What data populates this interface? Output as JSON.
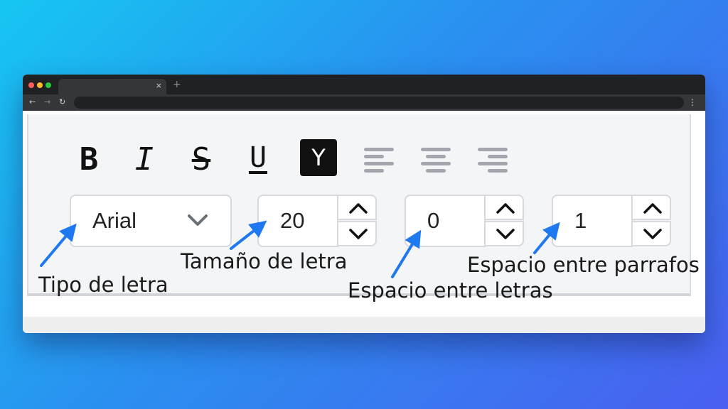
{
  "browser": {
    "tab_close": "×",
    "new_tab": "+",
    "back": "←",
    "forward": "→",
    "reload": "↻",
    "menu": "⋮"
  },
  "toolbar": {
    "bold": "B",
    "italic": "I",
    "strikethrough": "S",
    "underline": "U",
    "highlight": "Y",
    "align_icons": [
      "align-left-icon",
      "align-center-icon",
      "align-right-icon"
    ]
  },
  "controls": {
    "font_family": {
      "value": "Arial"
    },
    "font_size": {
      "value": "20"
    },
    "letter_spacing": {
      "value": "0"
    },
    "paragraph_spacing": {
      "value": "1"
    }
  },
  "annotations": {
    "font_family": "Tipo de letra",
    "font_size": "Tamaño de letra",
    "letter_spacing": "Espacio entre letras",
    "paragraph_spacing": "Espacio entre parrafos"
  },
  "colors": {
    "arrow": "#1e78f0",
    "icon": "#111111",
    "align_icon": "#a3a6ad",
    "chevron": "#6b6f76",
    "highlight_bg": "#111111"
  }
}
